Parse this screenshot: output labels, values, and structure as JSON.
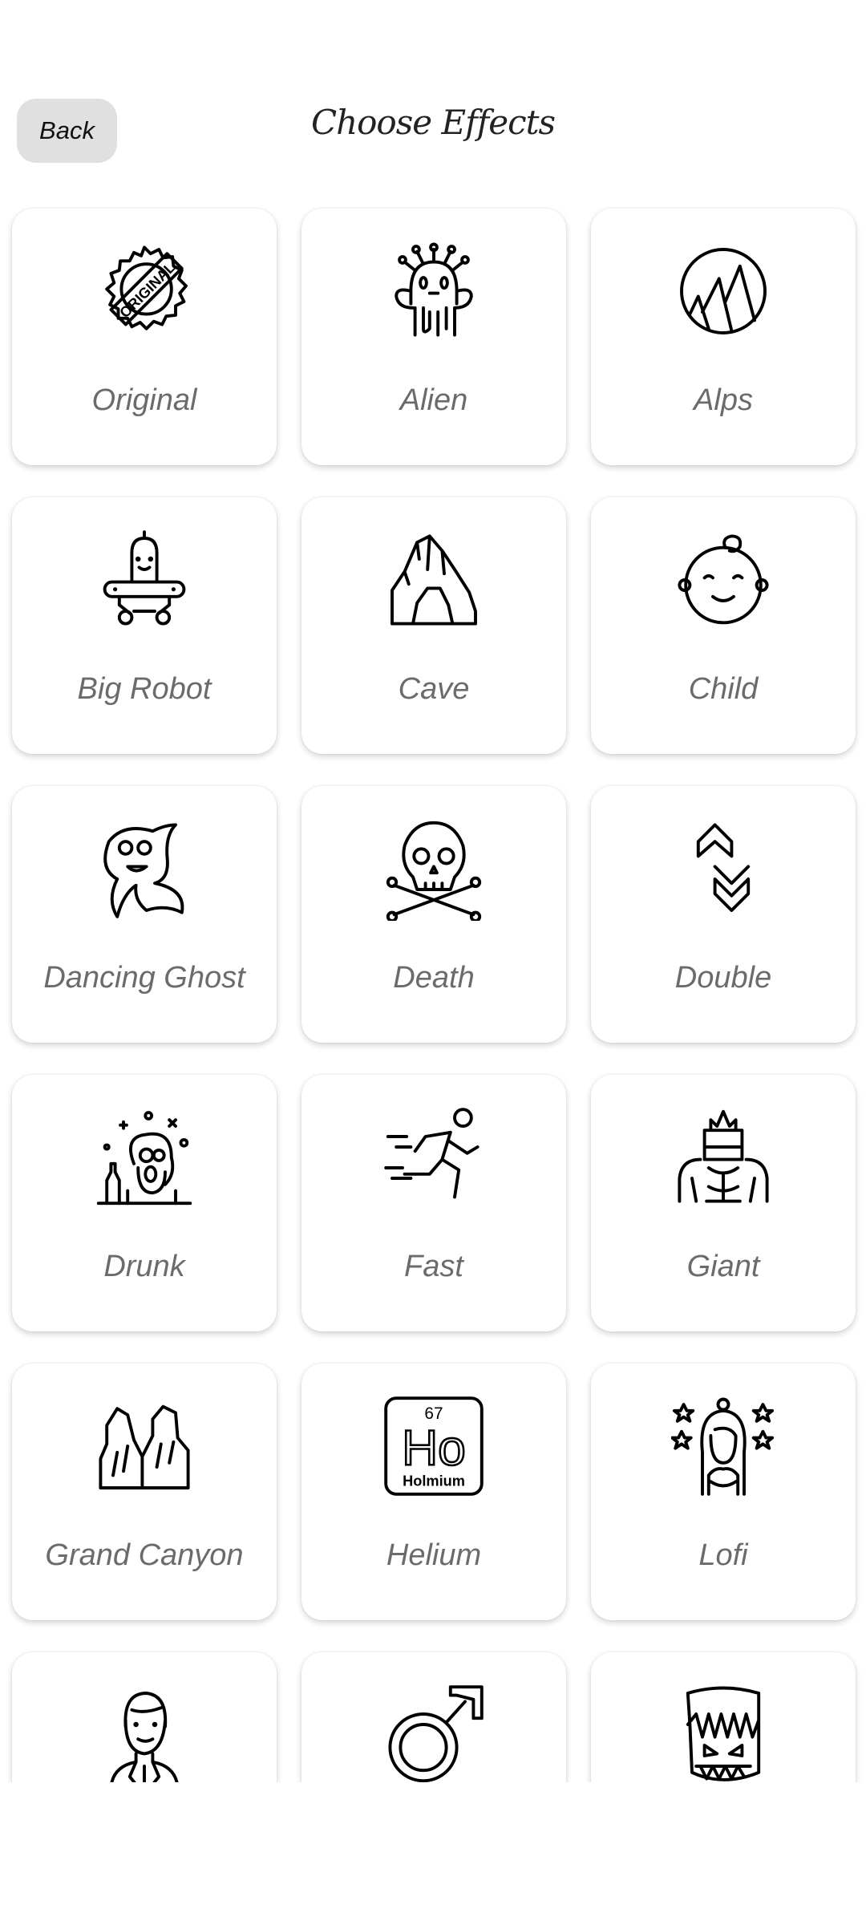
{
  "header": {
    "back_label": "Back",
    "title": "Choose Effects"
  },
  "effects": [
    {
      "label": "Original",
      "icon": "original-stamp-icon"
    },
    {
      "label": "Alien",
      "icon": "alien-icon"
    },
    {
      "label": "Alps",
      "icon": "mountains-icon"
    },
    {
      "label": "Big Robot",
      "icon": "robot-icon"
    },
    {
      "label": "Cave",
      "icon": "cave-icon"
    },
    {
      "label": "Child",
      "icon": "baby-face-icon"
    },
    {
      "label": "Dancing Ghost",
      "icon": "ghost-icon"
    },
    {
      "label": "Death",
      "icon": "skull-crossbones-icon"
    },
    {
      "label": "Double",
      "icon": "double-chevron-icon"
    },
    {
      "label": "Drunk",
      "icon": "drunk-person-icon"
    },
    {
      "label": "Fast",
      "icon": "running-man-icon"
    },
    {
      "label": "Giant",
      "icon": "giant-icon"
    },
    {
      "label": "Grand Canyon",
      "icon": "canyon-icon"
    },
    {
      "label": "Helium",
      "icon": "holmium-element-icon",
      "icon_text": {
        "number": "67",
        "symbol": "Ho",
        "name": "Holmium"
      }
    },
    {
      "label": "Lofi",
      "icon": "girl-stars-icon"
    },
    {
      "label": "",
      "icon": "man-icon"
    },
    {
      "label": "",
      "icon": "male-symbol-icon"
    },
    {
      "label": "",
      "icon": "monster-icon"
    }
  ]
}
